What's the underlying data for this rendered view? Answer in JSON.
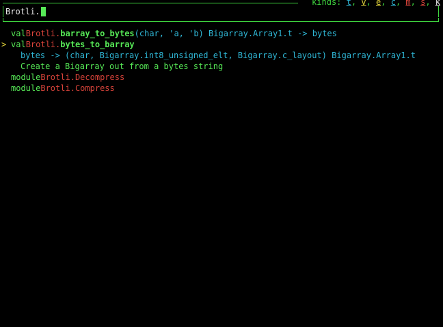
{
  "search": {
    "query": "Brotli.",
    "kinds_label": "kinds:",
    "kinds": [
      "t",
      "v",
      "e",
      "c",
      "m",
      "s",
      "k"
    ]
  },
  "results": [
    {
      "selected": false,
      "kind": "val",
      "module": "Brotli",
      "name": "barray_to_bytes",
      "signature": "(char, 'a, 'b) Bigarray.Array1.t -> bytes"
    },
    {
      "selected": true,
      "marker": ">",
      "kind": "val",
      "module": "Brotli",
      "name": "bytes_to_barray",
      "detail_signature": "bytes -> (char, Bigarray.int8_unsigned_elt, Bigarray.c_layout) Bigarray.Array1.t",
      "doc": "Create a Bigarray out from a bytes string"
    },
    {
      "selected": false,
      "kind": "module",
      "module": "Brotli",
      "name": "Decompress"
    },
    {
      "selected": false,
      "kind": "module",
      "module": "Brotli",
      "name": "Compress"
    }
  ],
  "colors": {
    "background": "#000000",
    "frame": "#3fd63f",
    "keyword": "#56e856",
    "module": "#d8433a",
    "type": "#2fb7d6",
    "marker": "#e0d23a",
    "cursor": "#56e856"
  }
}
